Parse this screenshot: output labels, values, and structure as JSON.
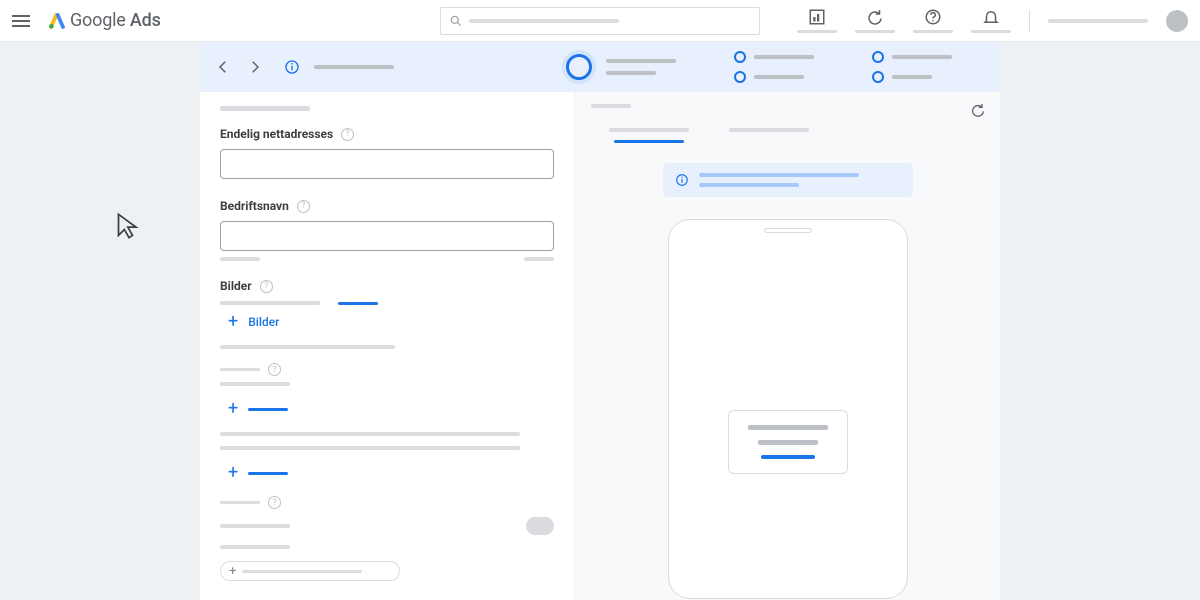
{
  "header": {
    "product_name_1": "Google",
    "product_name_2": "Ads"
  },
  "form": {
    "final_url_label": "Endelig nettadresses",
    "business_name_label": "Bedriftsnavn",
    "images_label": "Bilder",
    "add_images_link": "Bilder"
  }
}
